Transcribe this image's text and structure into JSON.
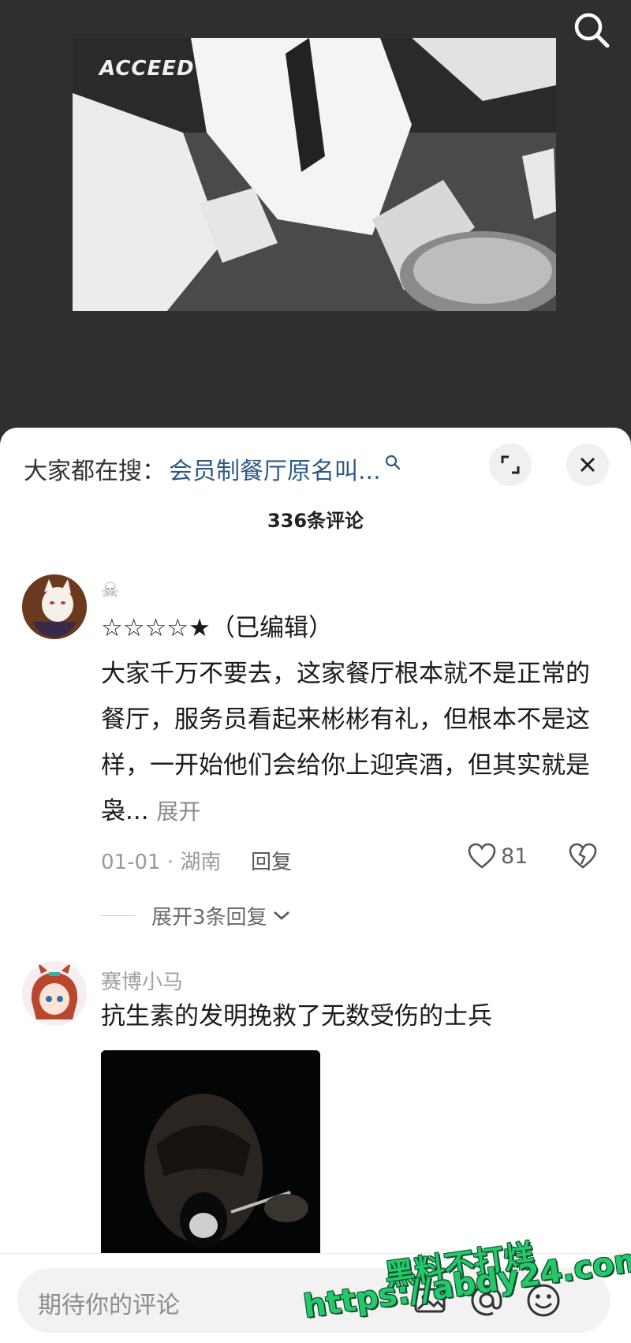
{
  "video": {
    "watermark": "ACCEED"
  },
  "hot_search": {
    "prefix": "大家都在搜：",
    "query": "会员制餐厅原名叫..."
  },
  "comments_title": "336条评论",
  "comments": [
    {
      "user": "☠",
      "text": "☆☆☆☆★（已编辑）",
      "body": "大家千万不要去，这家餐厅根本就不是正常的餐厅，服务员看起来彬彬有礼，但根本不是这样，一开始他们会给你上迎宾酒，但其实就是袅...",
      "expand": "展开",
      "date_location": "01-01 · 湖南",
      "reply": "回复",
      "likes": "81",
      "more_replies": "展开3条回复"
    },
    {
      "user": "赛博小马",
      "body": "抗生素的发明挽救了无数受伤的士兵"
    }
  ],
  "input": {
    "placeholder": "期待你的评论"
  },
  "overlay": {
    "line1": "黑料不打烊",
    "line2": "https://abdy24.com"
  },
  "colors": {
    "link": "#2d5b86",
    "promo": "#23c96a"
  }
}
